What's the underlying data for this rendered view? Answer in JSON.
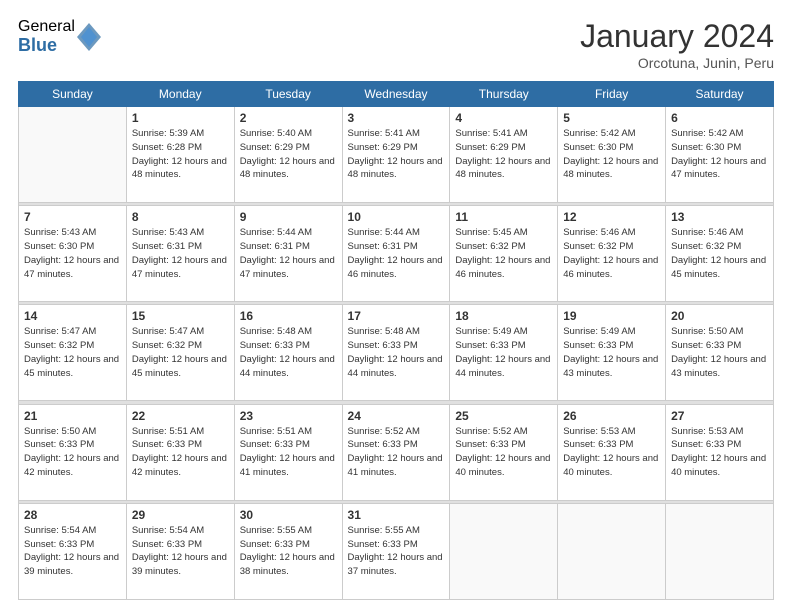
{
  "logo": {
    "general": "General",
    "blue": "Blue"
  },
  "title": "January 2024",
  "subtitle": "Orcotuna, Junin, Peru",
  "days_of_week": [
    "Sunday",
    "Monday",
    "Tuesday",
    "Wednesday",
    "Thursday",
    "Friday",
    "Saturday"
  ],
  "weeks": [
    [
      {
        "day": "",
        "empty": true
      },
      {
        "day": "1",
        "sunrise": "5:39 AM",
        "sunset": "6:28 PM",
        "daylight": "12 hours and 48 minutes."
      },
      {
        "day": "2",
        "sunrise": "5:40 AM",
        "sunset": "6:29 PM",
        "daylight": "12 hours and 48 minutes."
      },
      {
        "day": "3",
        "sunrise": "5:41 AM",
        "sunset": "6:29 PM",
        "daylight": "12 hours and 48 minutes."
      },
      {
        "day": "4",
        "sunrise": "5:41 AM",
        "sunset": "6:29 PM",
        "daylight": "12 hours and 48 minutes."
      },
      {
        "day": "5",
        "sunrise": "5:42 AM",
        "sunset": "6:30 PM",
        "daylight": "12 hours and 48 minutes."
      },
      {
        "day": "6",
        "sunrise": "5:42 AM",
        "sunset": "6:30 PM",
        "daylight": "12 hours and 47 minutes."
      }
    ],
    [
      {
        "day": "7",
        "sunrise": "5:43 AM",
        "sunset": "6:30 PM",
        "daylight": "12 hours and 47 minutes."
      },
      {
        "day": "8",
        "sunrise": "5:43 AM",
        "sunset": "6:31 PM",
        "daylight": "12 hours and 47 minutes."
      },
      {
        "day": "9",
        "sunrise": "5:44 AM",
        "sunset": "6:31 PM",
        "daylight": "12 hours and 47 minutes."
      },
      {
        "day": "10",
        "sunrise": "5:44 AM",
        "sunset": "6:31 PM",
        "daylight": "12 hours and 46 minutes."
      },
      {
        "day": "11",
        "sunrise": "5:45 AM",
        "sunset": "6:32 PM",
        "daylight": "12 hours and 46 minutes."
      },
      {
        "day": "12",
        "sunrise": "5:46 AM",
        "sunset": "6:32 PM",
        "daylight": "12 hours and 46 minutes."
      },
      {
        "day": "13",
        "sunrise": "5:46 AM",
        "sunset": "6:32 PM",
        "daylight": "12 hours and 45 minutes."
      }
    ],
    [
      {
        "day": "14",
        "sunrise": "5:47 AM",
        "sunset": "6:32 PM",
        "daylight": "12 hours and 45 minutes."
      },
      {
        "day": "15",
        "sunrise": "5:47 AM",
        "sunset": "6:32 PM",
        "daylight": "12 hours and 45 minutes."
      },
      {
        "day": "16",
        "sunrise": "5:48 AM",
        "sunset": "6:33 PM",
        "daylight": "12 hours and 44 minutes."
      },
      {
        "day": "17",
        "sunrise": "5:48 AM",
        "sunset": "6:33 PM",
        "daylight": "12 hours and 44 minutes."
      },
      {
        "day": "18",
        "sunrise": "5:49 AM",
        "sunset": "6:33 PM",
        "daylight": "12 hours and 44 minutes."
      },
      {
        "day": "19",
        "sunrise": "5:49 AM",
        "sunset": "6:33 PM",
        "daylight": "12 hours and 43 minutes."
      },
      {
        "day": "20",
        "sunrise": "5:50 AM",
        "sunset": "6:33 PM",
        "daylight": "12 hours and 43 minutes."
      }
    ],
    [
      {
        "day": "21",
        "sunrise": "5:50 AM",
        "sunset": "6:33 PM",
        "daylight": "12 hours and 42 minutes."
      },
      {
        "day": "22",
        "sunrise": "5:51 AM",
        "sunset": "6:33 PM",
        "daylight": "12 hours and 42 minutes."
      },
      {
        "day": "23",
        "sunrise": "5:51 AM",
        "sunset": "6:33 PM",
        "daylight": "12 hours and 41 minutes."
      },
      {
        "day": "24",
        "sunrise": "5:52 AM",
        "sunset": "6:33 PM",
        "daylight": "12 hours and 41 minutes."
      },
      {
        "day": "25",
        "sunrise": "5:52 AM",
        "sunset": "6:33 PM",
        "daylight": "12 hours and 40 minutes."
      },
      {
        "day": "26",
        "sunrise": "5:53 AM",
        "sunset": "6:33 PM",
        "daylight": "12 hours and 40 minutes."
      },
      {
        "day": "27",
        "sunrise": "5:53 AM",
        "sunset": "6:33 PM",
        "daylight": "12 hours and 40 minutes."
      }
    ],
    [
      {
        "day": "28",
        "sunrise": "5:54 AM",
        "sunset": "6:33 PM",
        "daylight": "12 hours and 39 minutes."
      },
      {
        "day": "29",
        "sunrise": "5:54 AM",
        "sunset": "6:33 PM",
        "daylight": "12 hours and 39 minutes."
      },
      {
        "day": "30",
        "sunrise": "5:55 AM",
        "sunset": "6:33 PM",
        "daylight": "12 hours and 38 minutes."
      },
      {
        "day": "31",
        "sunrise": "5:55 AM",
        "sunset": "6:33 PM",
        "daylight": "12 hours and 37 minutes."
      },
      {
        "day": "",
        "empty": true
      },
      {
        "day": "",
        "empty": true
      },
      {
        "day": "",
        "empty": true
      }
    ]
  ]
}
